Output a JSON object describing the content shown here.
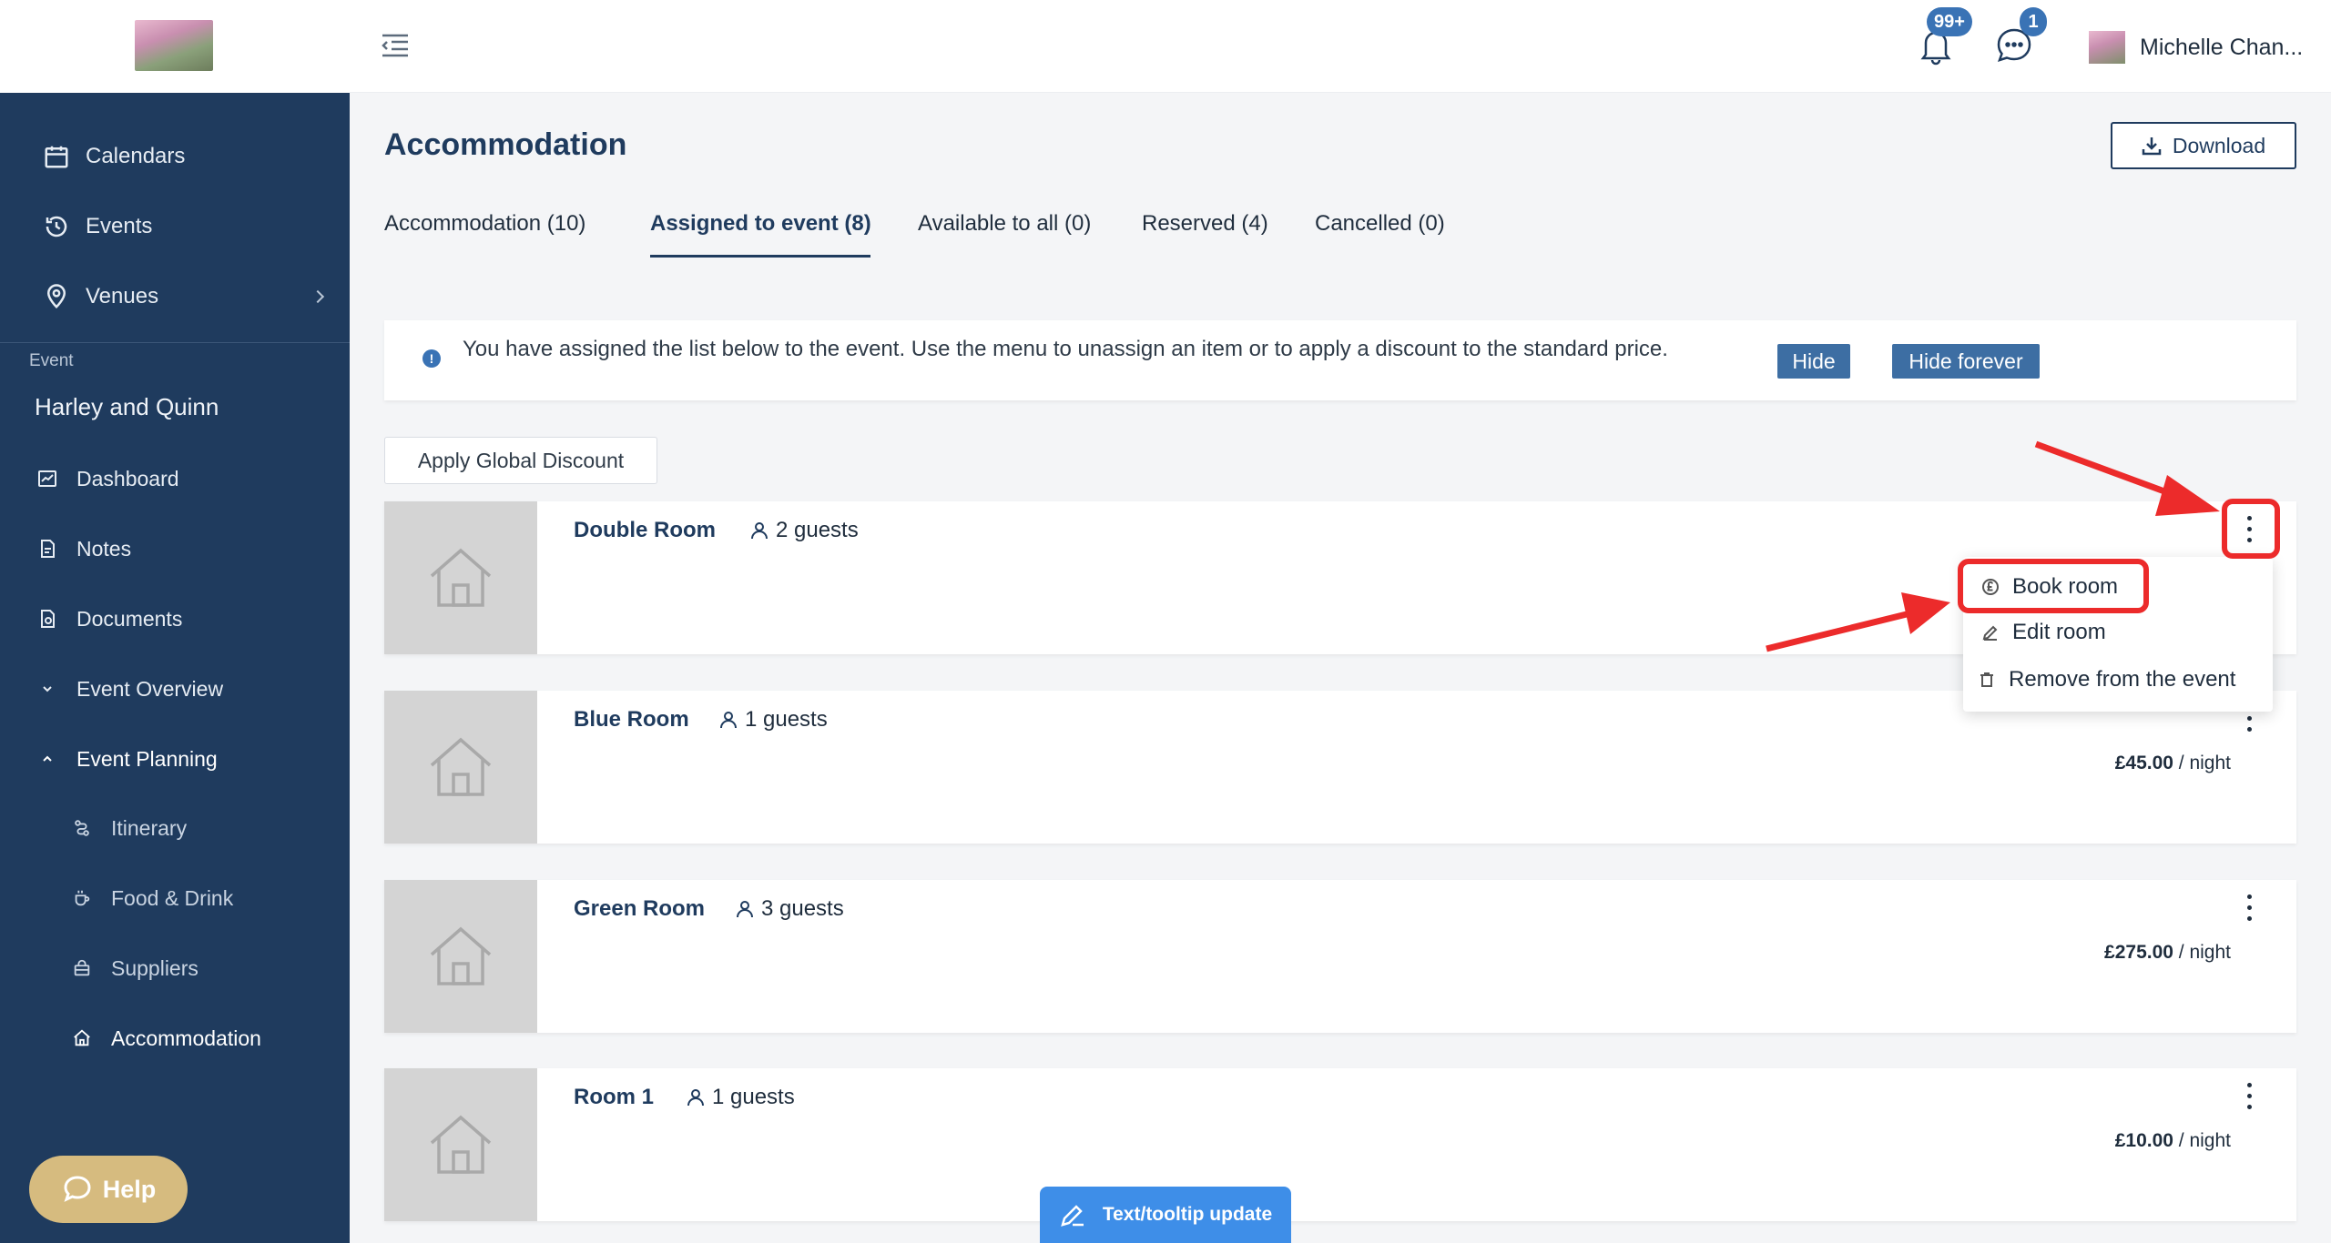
{
  "sidebar": {
    "nav_top": [
      {
        "label": "Calendars",
        "icon": "calendar-icon"
      },
      {
        "label": "Events",
        "icon": "clock-history-icon"
      },
      {
        "label": "Venues",
        "icon": "location-pin-icon"
      }
    ],
    "section_label": "Event",
    "event_name": "Harley and Quinn",
    "nav_event": [
      {
        "label": "Dashboard",
        "icon": "chart-icon"
      },
      {
        "label": "Notes",
        "icon": "note-icon"
      },
      {
        "label": "Documents",
        "icon": "document-icon"
      },
      {
        "label": "Event Overview",
        "icon": "chevron-down-icon"
      },
      {
        "label": "Event Planning",
        "icon": "chevron-up-icon"
      }
    ],
    "nav_planning": [
      {
        "label": "Itinerary",
        "icon": "route-icon"
      },
      {
        "label": "Food & Drink",
        "icon": "coffee-icon"
      },
      {
        "label": "Suppliers",
        "icon": "bag-icon"
      },
      {
        "label": "Accommodation",
        "icon": "home-icon"
      }
    ],
    "help_label": "Help"
  },
  "topbar": {
    "notifications_badge": "99+",
    "messages_badge": "1",
    "user_name": "Michelle Chan..."
  },
  "page": {
    "title": "Accommodation",
    "download_label": "Download",
    "tabs": [
      {
        "label": "Accommodation (10)"
      },
      {
        "label": "Assigned to event (8)"
      },
      {
        "label": "Available to all (0)"
      },
      {
        "label": "Reserved (4)"
      },
      {
        "label": "Cancelled (0)"
      }
    ],
    "info_text": "You have assigned the list below to the event. Use the menu to unassign an item or to apply a discount to the standard price.",
    "info_hide": "Hide",
    "info_hide_forever": "Hide forever",
    "global_discount": "Apply Global Discount"
  },
  "rooms": [
    {
      "name": "Double Room",
      "guests": "2 guests",
      "price": "",
      "unit": ""
    },
    {
      "name": "Blue Room",
      "guests": "1 guests",
      "price": "£45.00",
      "unit": " / night"
    },
    {
      "name": "Green Room",
      "guests": "3 guests",
      "price": "£275.00",
      "unit": " / night"
    },
    {
      "name": "Room 1",
      "guests": "1 guests",
      "price": "£10.00",
      "unit": " / night"
    }
  ],
  "dropdown": {
    "items": [
      {
        "label": "Book room",
        "icon": "pound-coin-icon"
      },
      {
        "label": "Edit room",
        "icon": "pencil-icon"
      },
      {
        "label": "Remove from the event",
        "icon": "trash-icon"
      }
    ]
  },
  "feedback": {
    "label": "Text/tooltip update"
  },
  "colors": {
    "sidebar": "#1f3b5e",
    "accent": "#3a73b5",
    "annotation": "#ec2b2b",
    "help": "#d6bb7f"
  }
}
